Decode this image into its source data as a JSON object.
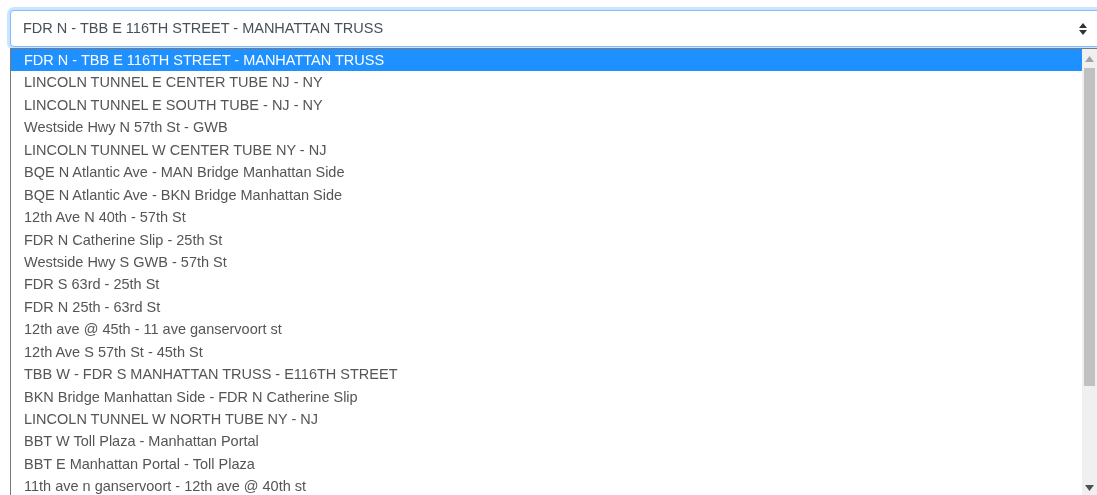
{
  "select": {
    "value": "FDR N - TBB E 116TH STREET - MANHATTAN TRUSS"
  },
  "options": [
    {
      "label": "FDR N - TBB E 116TH STREET - MANHATTAN TRUSS",
      "selected": true
    },
    {
      "label": "LINCOLN TUNNEL E CENTER TUBE NJ - NY",
      "selected": false
    },
    {
      "label": "LINCOLN TUNNEL E SOUTH TUBE - NJ - NY",
      "selected": false
    },
    {
      "label": "Westside Hwy N 57th St - GWB",
      "selected": false
    },
    {
      "label": "LINCOLN TUNNEL W CENTER TUBE NY - NJ",
      "selected": false
    },
    {
      "label": "BQE N Atlantic Ave - MAN Bridge Manhattan Side",
      "selected": false
    },
    {
      "label": "BQE N Atlantic Ave - BKN Bridge Manhattan Side",
      "selected": false
    },
    {
      "label": "12th Ave N 40th - 57th St",
      "selected": false
    },
    {
      "label": "FDR N Catherine Slip - 25th St",
      "selected": false
    },
    {
      "label": "Westside Hwy S GWB - 57th St",
      "selected": false
    },
    {
      "label": "FDR S 63rd - 25th St",
      "selected": false
    },
    {
      "label": "FDR N 25th - 63rd St",
      "selected": false
    },
    {
      "label": "12th ave @ 45th - 11 ave ganservoort st",
      "selected": false
    },
    {
      "label": "12th Ave S 57th St - 45th St",
      "selected": false
    },
    {
      "label": "TBB W - FDR S MANHATTAN TRUSS - E116TH STREET",
      "selected": false
    },
    {
      "label": "BKN Bridge Manhattan Side - FDR N Catherine Slip",
      "selected": false
    },
    {
      "label": "LINCOLN TUNNEL W NORTH TUBE NY - NJ",
      "selected": false
    },
    {
      "label": "BBT W Toll Plaza - Manhattan Portal",
      "selected": false
    },
    {
      "label": "BBT E Manhattan Portal - Toll Plaza",
      "selected": false
    },
    {
      "label": "11th ave n ganservoort - 12th ave @ 40th st",
      "selected": false
    }
  ]
}
